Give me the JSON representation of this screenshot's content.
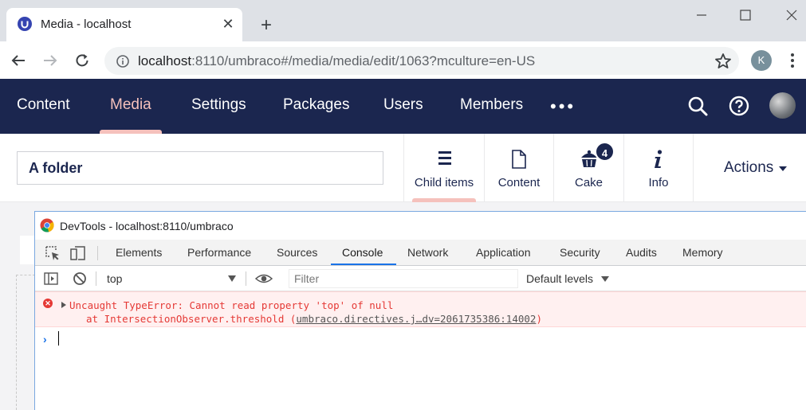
{
  "browser": {
    "tab_title": "Media - localhost",
    "close_glyph": "✕",
    "new_tab_glyph": "+",
    "url_host": "localhost",
    "url_rest": ":8110/umbraco#/media/media/edit/1063?mculture=en-US",
    "profile_initial": "K"
  },
  "umbraco": {
    "sections": [
      "Content",
      "Media",
      "Settings",
      "Packages",
      "Users",
      "Members"
    ],
    "more": "•••",
    "active_section": "Media",
    "node_name": "A folder",
    "apps": [
      {
        "label": "Child items",
        "icon": "list-icon"
      },
      {
        "label": "Content",
        "icon": "document-icon"
      },
      {
        "label": "Cake",
        "icon": "cake-icon"
      },
      {
        "label": "Info",
        "icon": "info-icon"
      }
    ],
    "cake_badge": "4",
    "actions_label": "Actions"
  },
  "devtools": {
    "title": "DevTools - localhost:8110/umbraco",
    "tabs": [
      "Elements",
      "Performance",
      "Sources",
      "Console",
      "Network",
      "Application",
      "Security",
      "Audits",
      "Memory"
    ],
    "active_tab": "Console",
    "context": "top",
    "filter_placeholder": "Filter",
    "levels": "Default levels",
    "error_icon": "✕",
    "error_line1": "Uncaught TypeError: Cannot read property 'top' of null",
    "error_line2_prefix": "at IntersectionObserver.threshold (",
    "error_link": "umbraco.directives.j…dv=2061735386:14002",
    "error_line2_suffix": ")",
    "prompt": "›"
  }
}
